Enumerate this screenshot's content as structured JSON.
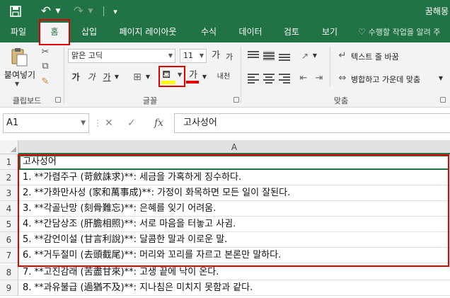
{
  "titlebar": {
    "doc_title": "꿈해몽",
    "save_icon": "save-icon",
    "undo_icon": "undo-icon",
    "redo_icon": "redo-icon"
  },
  "tabs": [
    {
      "label": "파일",
      "active": false
    },
    {
      "label": "홈",
      "active": true
    },
    {
      "label": "삽입",
      "active": false
    },
    {
      "label": "페이지 레이아웃",
      "active": false
    },
    {
      "label": "수식",
      "active": false
    },
    {
      "label": "데이터",
      "active": false
    },
    {
      "label": "검토",
      "active": false
    },
    {
      "label": "보기",
      "active": false
    }
  ],
  "tell_me": "수행할 작업을 알려 주",
  "ribbon": {
    "clipboard": {
      "paste_label": "붙여넣기",
      "group_label": "클립보드"
    },
    "font": {
      "font_name": "맑은 고딕",
      "font_size": "11",
      "grow_label": "가",
      "shrink_label": "가",
      "bold_label": "가",
      "italic_label": "가",
      "underline_label": "가",
      "fontcolor_label": "가",
      "phonetic_label": "내천",
      "group_label": "글꼴",
      "fill_color": "#ffff00",
      "font_color": "#e00000"
    },
    "alignment": {
      "wrap_label": "텍스트 줄 바꿈",
      "merge_label": "병합하고 가운데 맞춤",
      "group_label": "맞춤"
    }
  },
  "formula_bar": {
    "name_box": "A1",
    "cancel": "✕",
    "enter": "✓",
    "fx": "fx",
    "value": "고사성어"
  },
  "grid": {
    "column_header": "A",
    "rows": [
      {
        "num": "1",
        "text": "고사성어"
      },
      {
        "num": "2",
        "text": "1. **가렴주구 (苛斂誅求)**: 세금을 가혹하게 징수하다."
      },
      {
        "num": "3",
        "text": "2. **가화만사성 (家和萬事成)**: 가정이 화목하면 모든 일이 잘된다."
      },
      {
        "num": "4",
        "text": "3. **각골난망 (刻骨難忘)**: 은혜를 잊기 어려움."
      },
      {
        "num": "5",
        "text": "4. **간담상조 (肝膽相照)**: 서로 마음을 터놓고 사귐."
      },
      {
        "num": "6",
        "text": "5. **감언이설 (甘言利說)**: 달콤한 말과 이로운 말."
      },
      {
        "num": "7",
        "text": "6. **거두절미 (去頭截尾)**: 머리와 꼬리를 자르고 본론만 말하다."
      },
      {
        "num": "8",
        "text": "7. **고진감래 (苦盡甘來)**: 고생 끝에 낙이 온다."
      },
      {
        "num": "9",
        "text": "8. **과유불급 (過猶不及)**: 지나침은 미치지 못함과 같다."
      }
    ]
  },
  "colors": {
    "accent": "#217346",
    "highlight": "#e00000"
  }
}
